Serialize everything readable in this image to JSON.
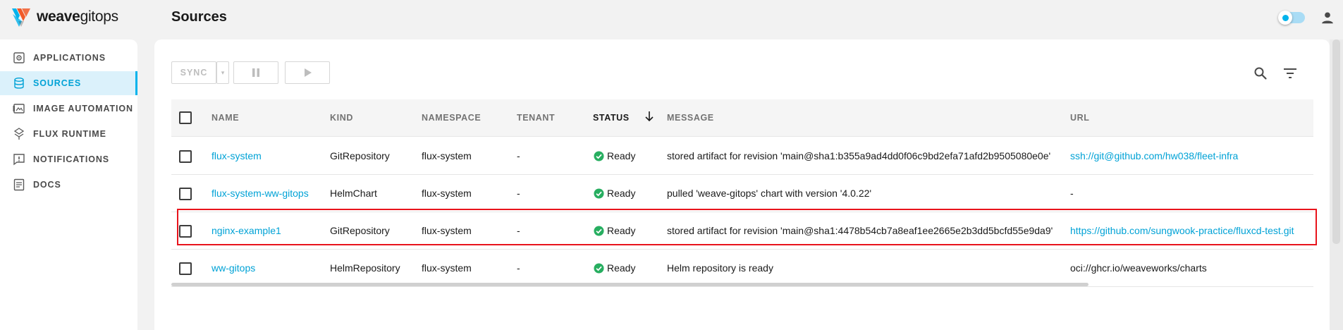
{
  "app": {
    "logo_bold": "weave",
    "logo_rest": "gitops",
    "page_title": "Sources"
  },
  "sidebar": {
    "items": [
      {
        "label": "APPLICATIONS",
        "icon": "applications-icon",
        "active": false
      },
      {
        "label": "SOURCES",
        "icon": "sources-icon",
        "active": true
      },
      {
        "label": "IMAGE AUTOMATION",
        "icon": "image-automation-icon",
        "active": false
      },
      {
        "label": "FLUX RUNTIME",
        "icon": "flux-runtime-icon",
        "active": false
      },
      {
        "label": "NOTIFICATIONS",
        "icon": "notifications-icon",
        "active": false
      },
      {
        "label": "DOCS",
        "icon": "docs-icon",
        "active": false
      }
    ]
  },
  "toolbar": {
    "sync_label": "SYNC",
    "caret_glyph": "▾"
  },
  "table": {
    "columns": [
      "NAME",
      "KIND",
      "NAMESPACE",
      "TENANT",
      "STATUS",
      "MESSAGE",
      "URL"
    ],
    "sorted_column": "STATUS",
    "rows": [
      {
        "name": "flux-system",
        "kind": "GitRepository",
        "namespace": "flux-system",
        "tenant": "-",
        "status": "Ready",
        "message": "stored artifact for revision 'main@sha1:b355a9ad4dd0f06c9bd2efa71afd2b9505080e0e'",
        "url": "ssh://git@github.com/hw038/fleet-infra",
        "url_is_link": true
      },
      {
        "name": "flux-system-ww-gitops",
        "kind": "HelmChart",
        "namespace": "flux-system",
        "tenant": "-",
        "status": "Ready",
        "message": "pulled 'weave-gitops' chart with version '4.0.22'",
        "url": "-",
        "url_is_link": false
      },
      {
        "name": "nginx-example1",
        "kind": "GitRepository",
        "namespace": "flux-system",
        "tenant": "-",
        "status": "Ready",
        "message": "stored artifact for revision 'main@sha1:4478b54cb7a8eaf1ee2665e2b3dd5bcfd55e9da9'",
        "url": "https://github.com/sungwook-practice/fluxcd-test.git",
        "url_is_link": true
      },
      {
        "name": "ww-gitops",
        "kind": "HelmRepository",
        "namespace": "flux-system",
        "tenant": "-",
        "status": "Ready",
        "message": "Helm repository is ready",
        "url": "oci://ghcr.io/weaveworks/charts",
        "url_is_link": false
      }
    ]
  },
  "colors": {
    "accent": "#00b3ec",
    "link": "#00a2d6",
    "ready": "#27ae60",
    "highlight": "#e8141c"
  }
}
